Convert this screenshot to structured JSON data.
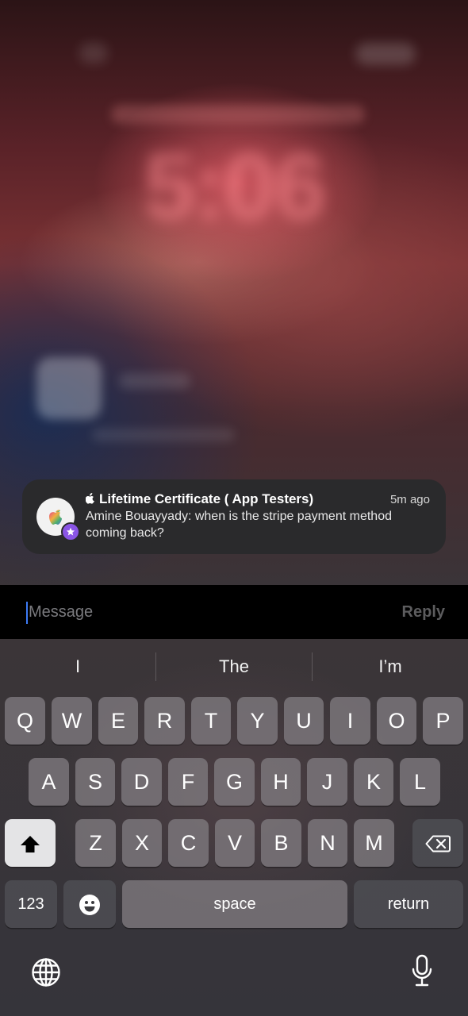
{
  "notification": {
    "title": "Lifetime Certificate ( App Testers)",
    "time": "5m ago",
    "body": "Amine Bouayyady: when is the stripe payment method coming back?",
    "app_icon": "apple-logo-icon",
    "badge_icon": "star-badge-icon"
  },
  "reply_bar": {
    "placeholder": "Message",
    "reply_label": "Reply"
  },
  "keyboard": {
    "suggestions": [
      "I",
      "The",
      "I’m"
    ],
    "row1": [
      "Q",
      "W",
      "E",
      "R",
      "T",
      "Y",
      "U",
      "I",
      "O",
      "P"
    ],
    "row2": [
      "A",
      "S",
      "D",
      "F",
      "G",
      "H",
      "J",
      "K",
      "L"
    ],
    "row3": [
      "Z",
      "X",
      "C",
      "V",
      "B",
      "N",
      "M"
    ],
    "numbers_label": "123",
    "space_label": "space",
    "return_label": "return",
    "icons": [
      "shift-icon",
      "backspace-icon",
      "emoji-icon",
      "globe-icon",
      "microphone-icon"
    ]
  }
}
